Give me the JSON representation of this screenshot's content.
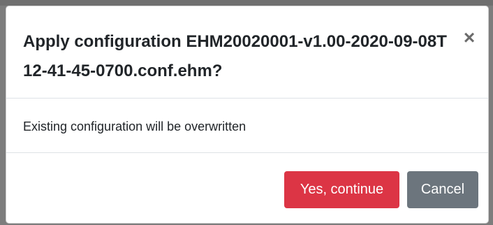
{
  "dialog": {
    "title": "Apply configuration EHM20020001-v1.00-2020-09-08T12-41-45-0700.conf.ehm?",
    "close_symbol": "×",
    "message": "Existing configuration will be overwritten",
    "confirm_label": "Yes, continue",
    "cancel_label": "Cancel"
  },
  "colors": {
    "confirm_button": "#dc3545",
    "cancel_button": "#6c757d",
    "backdrop": "#7d7d7d"
  },
  "icons": {
    "close": "close-icon"
  }
}
